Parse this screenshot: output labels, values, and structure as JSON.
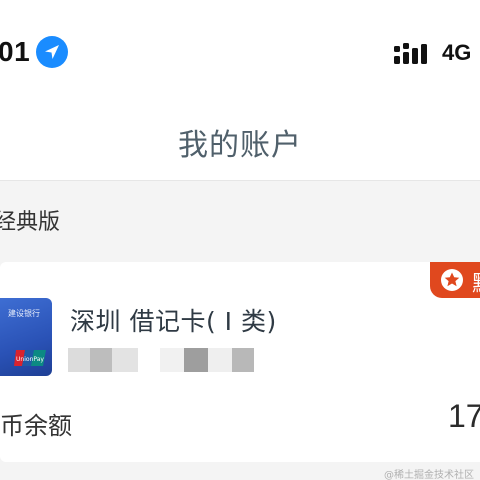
{
  "status_bar": {
    "time": "01",
    "location_icon": "location-arrow-icon",
    "signal_icon": "cellular-signal-icon",
    "network": "4G",
    "location_color": "#1a8cff"
  },
  "nav": {
    "title": "我的账户"
  },
  "section": {
    "title": "经典版"
  },
  "account_card": {
    "default_badge_icon": "star-icon",
    "default_badge_text": "默",
    "badge_color": "#e0481e",
    "bank_logo_icon": "bank-card-logo-icon",
    "logo_text": "建设银行",
    "unionpay_icon": "unionpay-icon",
    "unionpay_text": "UnionPay 银联",
    "card_name": "深圳 借记卡( I 类)",
    "card_number_masked": "masked",
    "balance_label": "币余额",
    "balance_value": "17"
  },
  "watermark": "@稀土掘金技术社区"
}
